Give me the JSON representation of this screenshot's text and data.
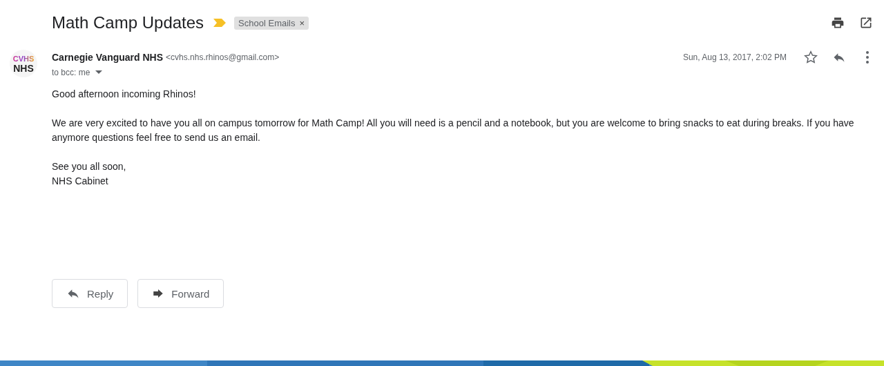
{
  "subject": "Math Camp Updates",
  "important": true,
  "labels": [
    {
      "name": "School Emails",
      "remove": "×"
    }
  ],
  "sender": {
    "avatar_top": "CVHS",
    "avatar_bottom": "NHS",
    "name": "Carnegie Vanguard NHS",
    "email": "<cvhs.nhs.rhinos@gmail.com>",
    "recipients": "to bcc: me",
    "date": "Sun, Aug 13, 2017, 2:02 PM",
    "starred": false
  },
  "body": [
    "Good afternoon incoming Rhinos!",
    "We are very excited to have you all on campus tomorrow for Math Camp! All you will need is a pencil and a notebook, but you are welcome to bring snacks to eat during breaks. If you have anymore questions feel free to send us an email.",
    "See you all soon,\nNHS Cabinet"
  ],
  "actions": [
    {
      "kind": "reply",
      "label": "Reply"
    },
    {
      "kind": "forward",
      "label": "Forward"
    }
  ]
}
